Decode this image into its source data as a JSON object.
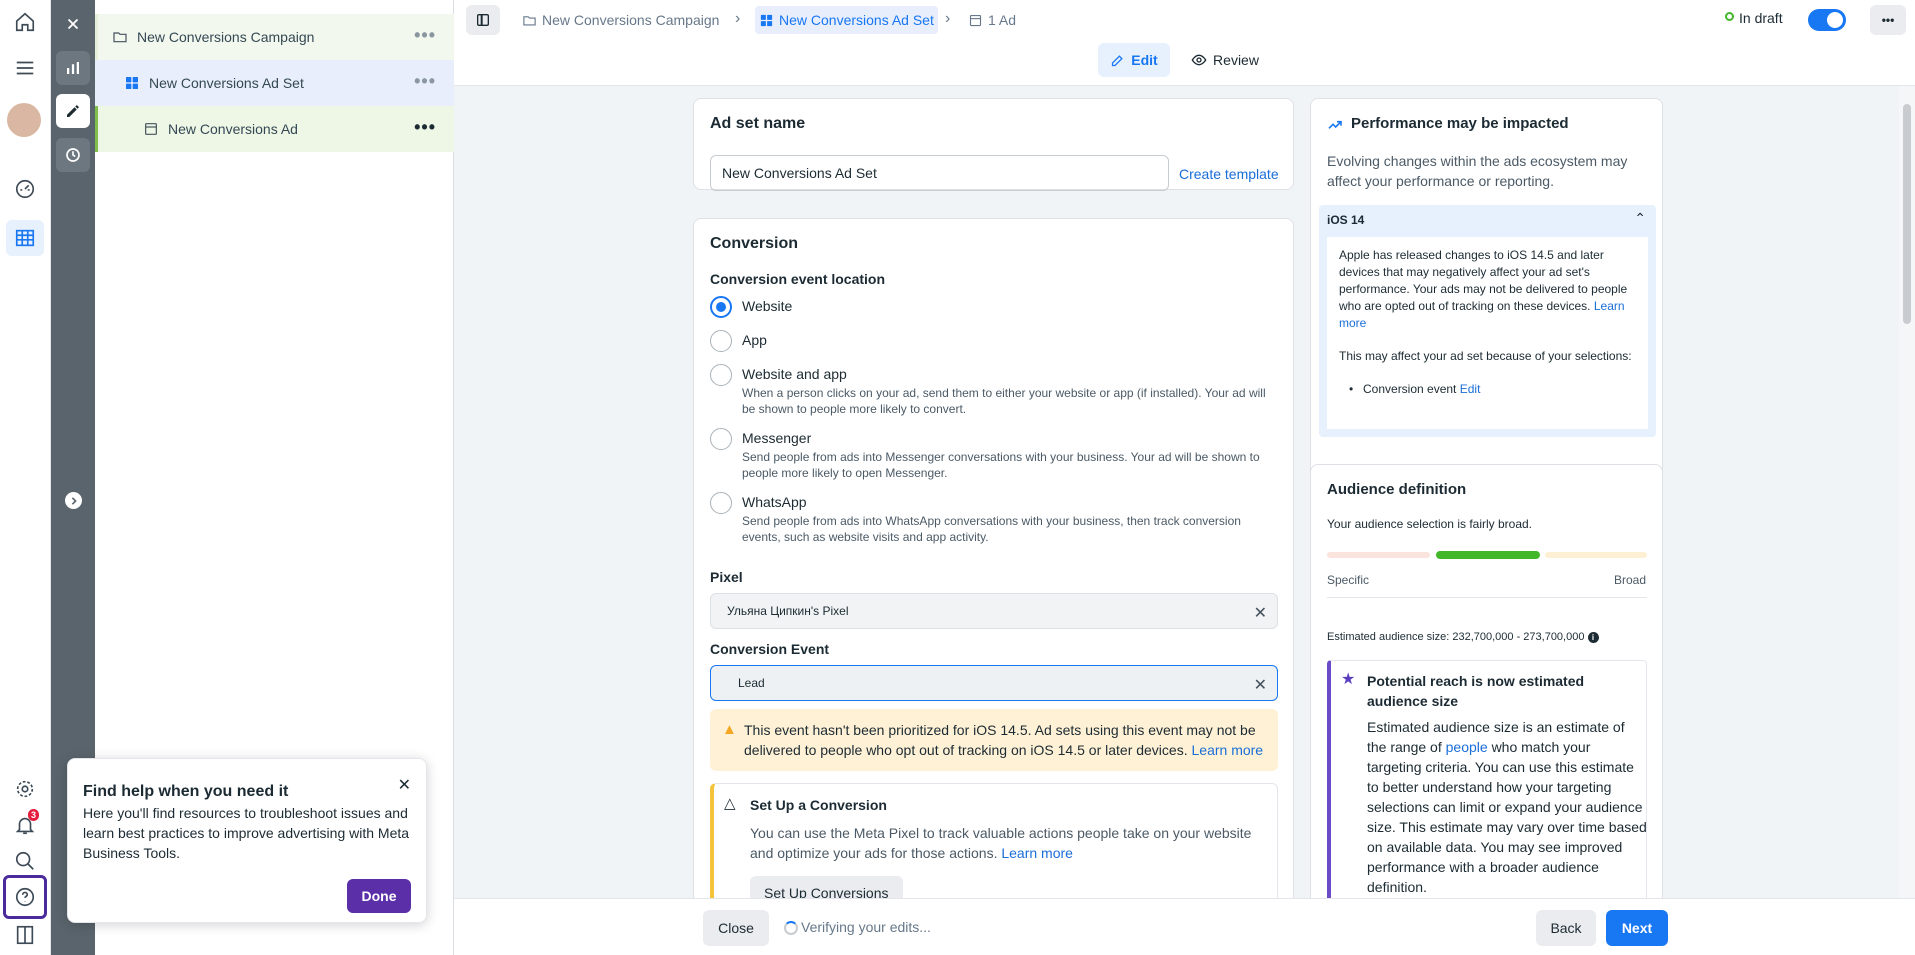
{
  "tree": {
    "campaign": "New Conversions Campaign",
    "adset": "New Conversions Ad Set",
    "ad": "New Conversions Ad",
    "dots": "•••"
  },
  "nav": {
    "notification_count": "3"
  },
  "topbar": {
    "crumb_campaign": "New Conversions Campaign",
    "crumb_adset": "New Conversions Ad Set",
    "crumb_ad": "1 Ad",
    "status": "In draft",
    "edit_tab": "Edit",
    "review_tab": "Review",
    "more": "•••"
  },
  "adset_name": {
    "title": "Ad set name",
    "value": "New Conversions Ad Set",
    "create_template": "Create template"
  },
  "conversion": {
    "title": "Conversion",
    "location_label": "Conversion event location",
    "options": [
      {
        "label": "Website",
        "desc": "",
        "selected": true
      },
      {
        "label": "App",
        "desc": "",
        "selected": false
      },
      {
        "label": "Website and app",
        "desc": "When a person clicks on your ad, send them to either your website or app (if installed). Your ad will be shown to people more likely to convert.",
        "selected": false
      },
      {
        "label": "Messenger",
        "desc": "Send people from ads into Messenger conversations with your business. Your ad will be shown to people more likely to open Messenger.",
        "selected": false
      },
      {
        "label": "WhatsApp",
        "desc": "Send people from ads into WhatsApp conversations with your business, then track conversion events, such as website visits and app activity.",
        "selected": false
      }
    ],
    "pixel_label": "Pixel",
    "pixel_value": "Ульяна Ципкин's Pixel",
    "event_label": "Conversion Event",
    "event_value": "Lead",
    "warning_text": "This event hasn't been prioritized for iOS 14.5. Ad sets using this event may not be delivered to people who opt out of tracking on iOS 14.5 or later devices.",
    "warning_link": "Learn more",
    "setup_title": "Set Up a Conversion",
    "setup_text": "You can use the Meta Pixel to track valuable actions people take on your website and optimize your ads for those actions.",
    "setup_link": "Learn more",
    "setup_button": "Set Up Conversions"
  },
  "performance": {
    "title": "Performance may be impacted",
    "text": "Evolving changes within the ads ecosystem may affect your performance or reporting.",
    "ios_label": "iOS 14",
    "ios_text": "Apple has released changes to iOS 14.5 and later devices that may negatively affect your ad set's performance. Your ads may not be delivered to people who are opted out of tracking on these devices.",
    "ios_link": "Learn more",
    "affect_text": "This may affect your ad set because of your selections:",
    "bullet_text": "Conversion event",
    "bullet_link": "Edit"
  },
  "audience": {
    "title": "Audience definition",
    "status": "Your audience selection is fairly broad.",
    "specific": "Specific",
    "broad": "Broad",
    "estimate": "Estimated audience size: 232,700,000 - 273,700,000",
    "info_title": "Potential reach is now estimated audience size",
    "info_text_1": "Estimated audience size is an estimate of the range of",
    "info_link": "people",
    "info_text_2": "who match your targeting criteria. You can use this estimate to better understand how your targeting selections can limit or expand your audience size. This estimate may vary over time based on available data. You may see improved performance with a broader audience definition."
  },
  "bottom": {
    "close": "Close",
    "verifying": "Verifying your edits...",
    "back": "Back",
    "next": "Next"
  },
  "popup": {
    "title": "Find help when you need it",
    "text": "Here you'll find resources to troubleshoot issues and learn best practices to improve advertising with Meta Business Tools.",
    "done": "Done"
  },
  "colors": {
    "accent": "#1877f2",
    "popup_button": "#5b2fa8",
    "warning_bg": "#fff1d5",
    "meter_green": "#42b72a"
  }
}
